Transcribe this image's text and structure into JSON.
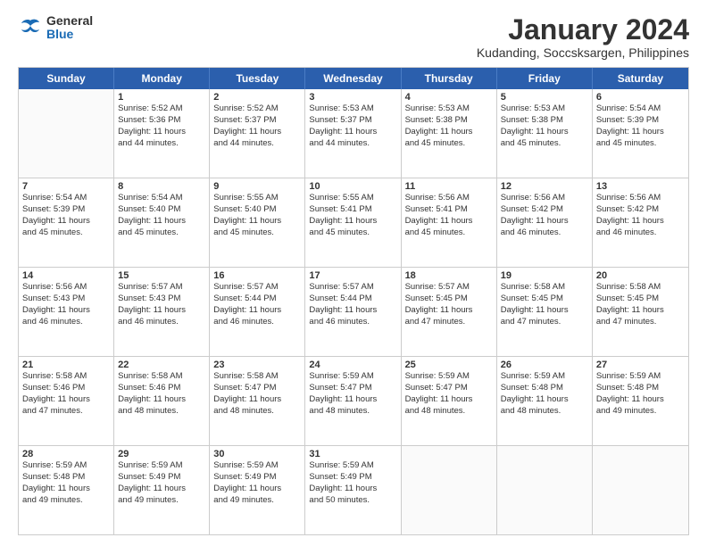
{
  "logo": {
    "general": "General",
    "blue": "Blue"
  },
  "title": "January 2024",
  "subtitle": "Kudanding, Soccsksargen, Philippines",
  "header_days": [
    "Sunday",
    "Monday",
    "Tuesday",
    "Wednesday",
    "Thursday",
    "Friday",
    "Saturday"
  ],
  "weeks": [
    [
      {
        "day": "",
        "lines": []
      },
      {
        "day": "1",
        "lines": [
          "Sunrise: 5:52 AM",
          "Sunset: 5:36 PM",
          "Daylight: 11 hours",
          "and 44 minutes."
        ]
      },
      {
        "day": "2",
        "lines": [
          "Sunrise: 5:52 AM",
          "Sunset: 5:37 PM",
          "Daylight: 11 hours",
          "and 44 minutes."
        ]
      },
      {
        "day": "3",
        "lines": [
          "Sunrise: 5:53 AM",
          "Sunset: 5:37 PM",
          "Daylight: 11 hours",
          "and 44 minutes."
        ]
      },
      {
        "day": "4",
        "lines": [
          "Sunrise: 5:53 AM",
          "Sunset: 5:38 PM",
          "Daylight: 11 hours",
          "and 45 minutes."
        ]
      },
      {
        "day": "5",
        "lines": [
          "Sunrise: 5:53 AM",
          "Sunset: 5:38 PM",
          "Daylight: 11 hours",
          "and 45 minutes."
        ]
      },
      {
        "day": "6",
        "lines": [
          "Sunrise: 5:54 AM",
          "Sunset: 5:39 PM",
          "Daylight: 11 hours",
          "and 45 minutes."
        ]
      }
    ],
    [
      {
        "day": "7",
        "lines": [
          "Sunrise: 5:54 AM",
          "Sunset: 5:39 PM",
          "Daylight: 11 hours",
          "and 45 minutes."
        ]
      },
      {
        "day": "8",
        "lines": [
          "Sunrise: 5:54 AM",
          "Sunset: 5:40 PM",
          "Daylight: 11 hours",
          "and 45 minutes."
        ]
      },
      {
        "day": "9",
        "lines": [
          "Sunrise: 5:55 AM",
          "Sunset: 5:40 PM",
          "Daylight: 11 hours",
          "and 45 minutes."
        ]
      },
      {
        "day": "10",
        "lines": [
          "Sunrise: 5:55 AM",
          "Sunset: 5:41 PM",
          "Daylight: 11 hours",
          "and 45 minutes."
        ]
      },
      {
        "day": "11",
        "lines": [
          "Sunrise: 5:56 AM",
          "Sunset: 5:41 PM",
          "Daylight: 11 hours",
          "and 45 minutes."
        ]
      },
      {
        "day": "12",
        "lines": [
          "Sunrise: 5:56 AM",
          "Sunset: 5:42 PM",
          "Daylight: 11 hours",
          "and 46 minutes."
        ]
      },
      {
        "day": "13",
        "lines": [
          "Sunrise: 5:56 AM",
          "Sunset: 5:42 PM",
          "Daylight: 11 hours",
          "and 46 minutes."
        ]
      }
    ],
    [
      {
        "day": "14",
        "lines": [
          "Sunrise: 5:56 AM",
          "Sunset: 5:43 PM",
          "Daylight: 11 hours",
          "and 46 minutes."
        ]
      },
      {
        "day": "15",
        "lines": [
          "Sunrise: 5:57 AM",
          "Sunset: 5:43 PM",
          "Daylight: 11 hours",
          "and 46 minutes."
        ]
      },
      {
        "day": "16",
        "lines": [
          "Sunrise: 5:57 AM",
          "Sunset: 5:44 PM",
          "Daylight: 11 hours",
          "and 46 minutes."
        ]
      },
      {
        "day": "17",
        "lines": [
          "Sunrise: 5:57 AM",
          "Sunset: 5:44 PM",
          "Daylight: 11 hours",
          "and 46 minutes."
        ]
      },
      {
        "day": "18",
        "lines": [
          "Sunrise: 5:57 AM",
          "Sunset: 5:45 PM",
          "Daylight: 11 hours",
          "and 47 minutes."
        ]
      },
      {
        "day": "19",
        "lines": [
          "Sunrise: 5:58 AM",
          "Sunset: 5:45 PM",
          "Daylight: 11 hours",
          "and 47 minutes."
        ]
      },
      {
        "day": "20",
        "lines": [
          "Sunrise: 5:58 AM",
          "Sunset: 5:45 PM",
          "Daylight: 11 hours",
          "and 47 minutes."
        ]
      }
    ],
    [
      {
        "day": "21",
        "lines": [
          "Sunrise: 5:58 AM",
          "Sunset: 5:46 PM",
          "Daylight: 11 hours",
          "and 47 minutes."
        ]
      },
      {
        "day": "22",
        "lines": [
          "Sunrise: 5:58 AM",
          "Sunset: 5:46 PM",
          "Daylight: 11 hours",
          "and 48 minutes."
        ]
      },
      {
        "day": "23",
        "lines": [
          "Sunrise: 5:58 AM",
          "Sunset: 5:47 PM",
          "Daylight: 11 hours",
          "and 48 minutes."
        ]
      },
      {
        "day": "24",
        "lines": [
          "Sunrise: 5:59 AM",
          "Sunset: 5:47 PM",
          "Daylight: 11 hours",
          "and 48 minutes."
        ]
      },
      {
        "day": "25",
        "lines": [
          "Sunrise: 5:59 AM",
          "Sunset: 5:47 PM",
          "Daylight: 11 hours",
          "and 48 minutes."
        ]
      },
      {
        "day": "26",
        "lines": [
          "Sunrise: 5:59 AM",
          "Sunset: 5:48 PM",
          "Daylight: 11 hours",
          "and 48 minutes."
        ]
      },
      {
        "day": "27",
        "lines": [
          "Sunrise: 5:59 AM",
          "Sunset: 5:48 PM",
          "Daylight: 11 hours",
          "and 49 minutes."
        ]
      }
    ],
    [
      {
        "day": "28",
        "lines": [
          "Sunrise: 5:59 AM",
          "Sunset: 5:48 PM",
          "Daylight: 11 hours",
          "and 49 minutes."
        ]
      },
      {
        "day": "29",
        "lines": [
          "Sunrise: 5:59 AM",
          "Sunset: 5:49 PM",
          "Daylight: 11 hours",
          "and 49 minutes."
        ]
      },
      {
        "day": "30",
        "lines": [
          "Sunrise: 5:59 AM",
          "Sunset: 5:49 PM",
          "Daylight: 11 hours",
          "and 49 minutes."
        ]
      },
      {
        "day": "31",
        "lines": [
          "Sunrise: 5:59 AM",
          "Sunset: 5:49 PM",
          "Daylight: 11 hours",
          "and 50 minutes."
        ]
      },
      {
        "day": "",
        "lines": []
      },
      {
        "day": "",
        "lines": []
      },
      {
        "day": "",
        "lines": []
      }
    ]
  ]
}
